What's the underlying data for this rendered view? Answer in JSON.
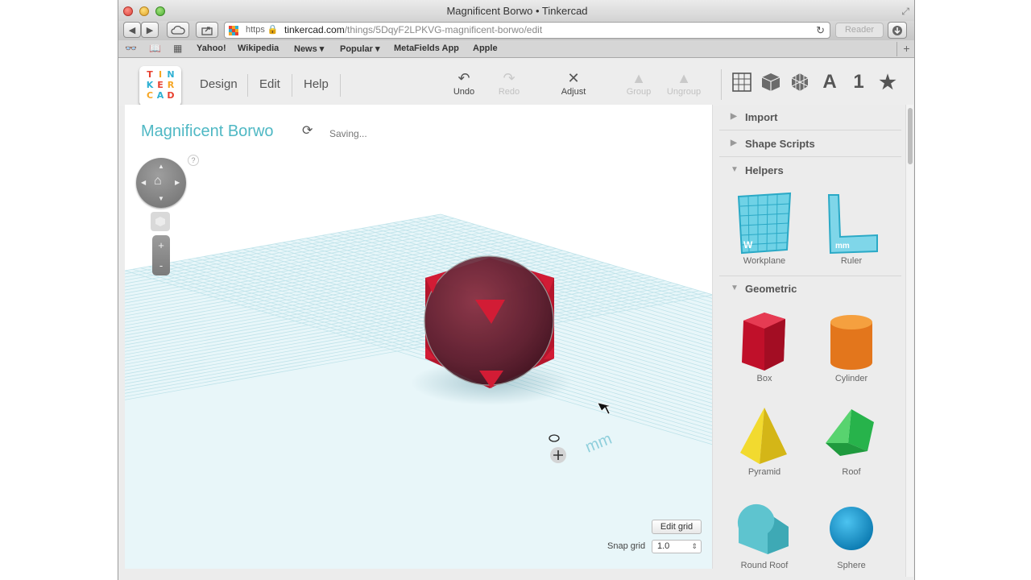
{
  "browser": {
    "window_title": "Magnificent Borwo • Tinkercad",
    "url_scheme": "https",
    "url_host": "tinkercad.com",
    "url_path": "/things/5DqyF2LPKVG-magnificent-borwo/edit",
    "reader_label": "Reader",
    "bookmarks": [
      "Yahoo!",
      "Wikipedia",
      "News ▾",
      "Popular ▾",
      "MetaFields App",
      "Apple"
    ]
  },
  "app": {
    "logo_letters": [
      "T",
      "I",
      "N",
      "K",
      "E",
      "R",
      "C",
      "A",
      "D"
    ],
    "logo_colors": [
      "#e8402f",
      "#f6a623",
      "#2eb0d3",
      "#2eb0d3",
      "#e8402f",
      "#f6a623",
      "#f6a623",
      "#2eb0d3",
      "#e8402f"
    ],
    "menu": [
      "Design",
      "Edit",
      "Help"
    ],
    "tools": {
      "undo": "Undo",
      "redo": "Redo",
      "adjust": "Adjust",
      "group": "Group",
      "ungroup": "Ungroup"
    },
    "view_icons": [
      "grid-view-icon",
      "box-view-icon",
      "sphere-view-icon",
      "text-view-icon",
      "number-view-icon",
      "star-view-icon"
    ],
    "view_text": {
      "letter": "A",
      "number": "1",
      "star": "★"
    }
  },
  "workspace": {
    "design_title": "Magnificent Borwo",
    "status": "Saving...",
    "help": "?",
    "zoom_in": "+",
    "zoom_out": "-",
    "unit_label": "mm",
    "edit_grid": "Edit grid",
    "snap_label": "Snap grid",
    "snap_value": "1.0",
    "colors": {
      "accent": "#4fb8c4",
      "grid": "#bfe3ea",
      "box": "#d3172e"
    }
  },
  "panel": {
    "sections": {
      "import": "Import",
      "shape_scripts": "Shape Scripts",
      "helpers": "Helpers",
      "geometric": "Geometric"
    },
    "helpers": [
      "Workplane",
      "Ruler"
    ],
    "shapes": [
      "Box",
      "Cylinder",
      "Pyramid",
      "Roof",
      "Round Roof",
      "Sphere"
    ],
    "workplane_tag": "W",
    "ruler_tag": "mm"
  }
}
